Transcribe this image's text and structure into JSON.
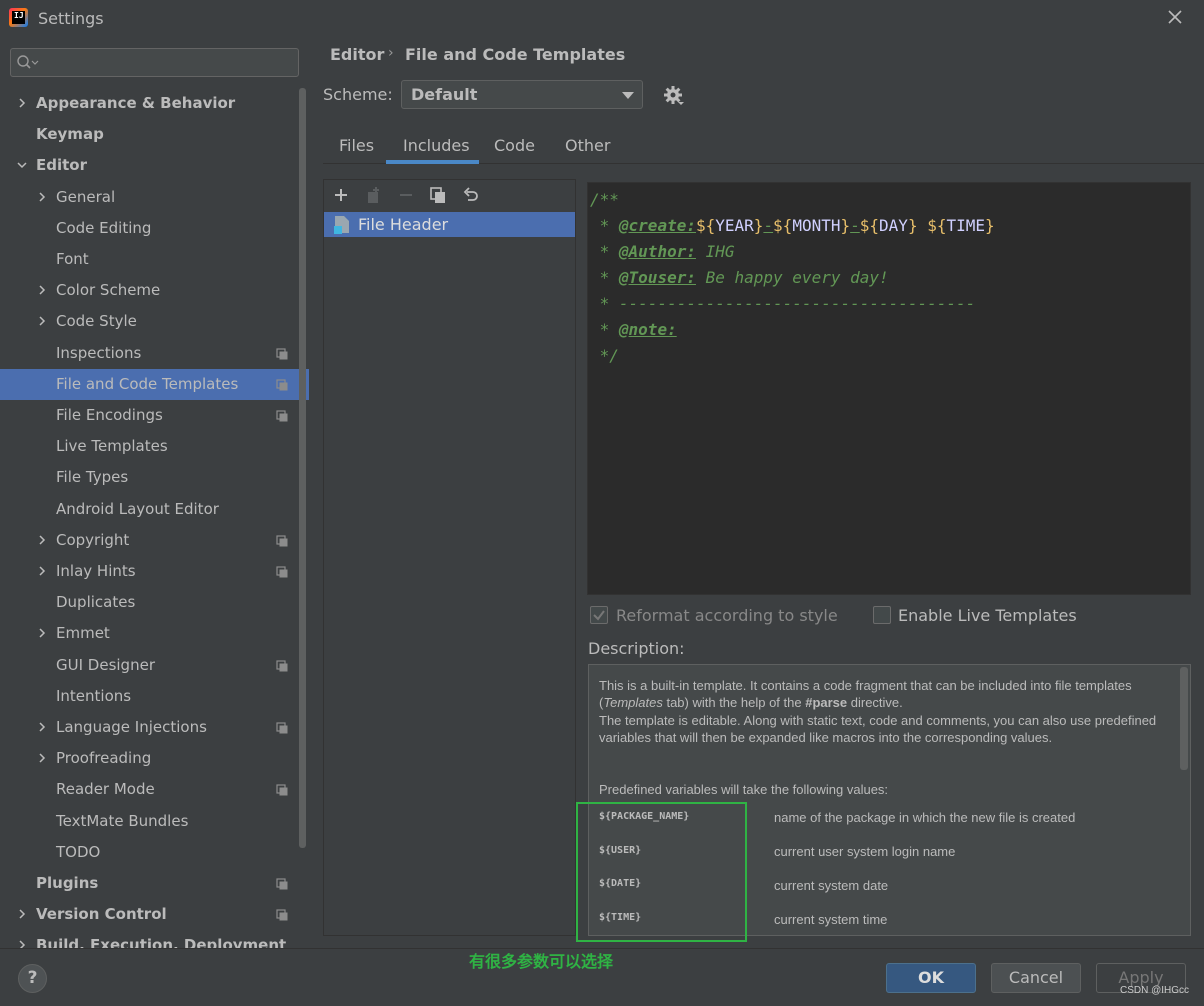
{
  "window": {
    "title": "Settings"
  },
  "search": {
    "placeholder": ""
  },
  "sidebar": {
    "items": [
      {
        "label": "Appearance & Behavior",
        "level": 0,
        "expandable": true,
        "expanded": false,
        "bold": true
      },
      {
        "label": "Keymap",
        "level": 0,
        "bold": true
      },
      {
        "label": "Editor",
        "level": 0,
        "expandable": true,
        "expanded": true,
        "bold": true
      },
      {
        "label": "General",
        "level": 1,
        "expandable": true
      },
      {
        "label": "Code Editing",
        "level": 1
      },
      {
        "label": "Font",
        "level": 1
      },
      {
        "label": "Color Scheme",
        "level": 1,
        "expandable": true
      },
      {
        "label": "Code Style",
        "level": 1,
        "expandable": true
      },
      {
        "label": "Inspections",
        "level": 1,
        "project": true
      },
      {
        "label": "File and Code Templates",
        "level": 1,
        "selected": true,
        "project": true
      },
      {
        "label": "File Encodings",
        "level": 1,
        "project": true
      },
      {
        "label": "Live Templates",
        "level": 1
      },
      {
        "label": "File Types",
        "level": 1
      },
      {
        "label": "Android Layout Editor",
        "level": 1
      },
      {
        "label": "Copyright",
        "level": 1,
        "expandable": true,
        "project": true
      },
      {
        "label": "Inlay Hints",
        "level": 1,
        "expandable": true,
        "project": true
      },
      {
        "label": "Duplicates",
        "level": 1
      },
      {
        "label": "Emmet",
        "level": 1,
        "expandable": true
      },
      {
        "label": "GUI Designer",
        "level": 1,
        "project": true
      },
      {
        "label": "Intentions",
        "level": 1
      },
      {
        "label": "Language Injections",
        "level": 1,
        "expandable": true,
        "project": true
      },
      {
        "label": "Proofreading",
        "level": 1,
        "expandable": true
      },
      {
        "label": "Reader Mode",
        "level": 1,
        "project": true
      },
      {
        "label": "TextMate Bundles",
        "level": 1
      },
      {
        "label": "TODO",
        "level": 1
      },
      {
        "label": "Plugins",
        "level": 0,
        "bold": true,
        "project": true
      },
      {
        "label": "Version Control",
        "level": 0,
        "expandable": true,
        "bold": true,
        "project": true
      },
      {
        "label": "Build, Execution, Deployment",
        "level": 0,
        "expandable": true,
        "bold": true
      }
    ]
  },
  "breadcrumb": {
    "parent": "Editor",
    "separator": "›",
    "current": "File and Code Templates"
  },
  "scheme": {
    "label": "Scheme:",
    "value": "Default"
  },
  "tabs": [
    {
      "label": "Files"
    },
    {
      "label": "Includes",
      "active": true
    },
    {
      "label": "Code"
    },
    {
      "label": "Other"
    }
  ],
  "template_list": {
    "items": [
      "File Header"
    ],
    "selected": "File Header"
  },
  "editor": {
    "lines": [
      "/**",
      " * @create:${YEAR}-${MONTH}-${DAY} ${TIME}",
      " * @Author: IHG",
      " * @Touser: Be happy every day!",
      " * -------------------------------------",
      " * @note:",
      " */"
    ],
    "tokens": {
      "open": "/**",
      "star": " * ",
      "create_tag": "@create:",
      "dollar_open": "${",
      "close": "}",
      "dash": "-",
      "space": " ",
      "year": "YEAR",
      "month": "MONTH",
      "day": "DAY",
      "time": "TIME",
      "author_tag": "@Author:",
      "author_val": " IHG",
      "touser_tag": "@Touser:",
      "touser_val": " Be happy every day!",
      "rule": " * -------------------------------------",
      "note_tag": "@note:",
      "end": " */"
    }
  },
  "options": {
    "reformat": {
      "label": "Reformat according to style",
      "checked": true,
      "disabled": true
    },
    "live_templates": {
      "label": "Enable Live Templates",
      "checked": false
    }
  },
  "description": {
    "label": "Description:",
    "intro_1": "This is a built-in template. It contains a code fragment that can be included into file templates (",
    "intro_em": "Templates",
    "intro_2": " tab) with the help of the ",
    "intro_b": "#parse",
    "intro_3": " directive.",
    "para2": "The template is editable. Along with static text, code and comments, you can also use predefined variables that will then be expanded like macros into the corresponding values.",
    "para3": "Predefined variables will take the following values:",
    "variables": [
      {
        "name": "${PACKAGE_NAME}",
        "desc": "name of the package in which the new file is created"
      },
      {
        "name": "${USER}",
        "desc": "current user system login name"
      },
      {
        "name": "${DATE}",
        "desc": "current system date"
      },
      {
        "name": "${TIME}",
        "desc": "current system time"
      }
    ]
  },
  "annotation": "有很多参数可以选择",
  "buttons": {
    "help": "?",
    "ok": "OK",
    "cancel": "Cancel",
    "apply": "Apply"
  },
  "watermark": "CSDN @IHGcc",
  "colors": {
    "accent": "#4b6eaf",
    "tab_underline": "#4a88c7",
    "annotation_green": "#2fb344",
    "ok_button": "#365880",
    "doc_comment": "#629755",
    "template_var": "#e8bf6a"
  }
}
